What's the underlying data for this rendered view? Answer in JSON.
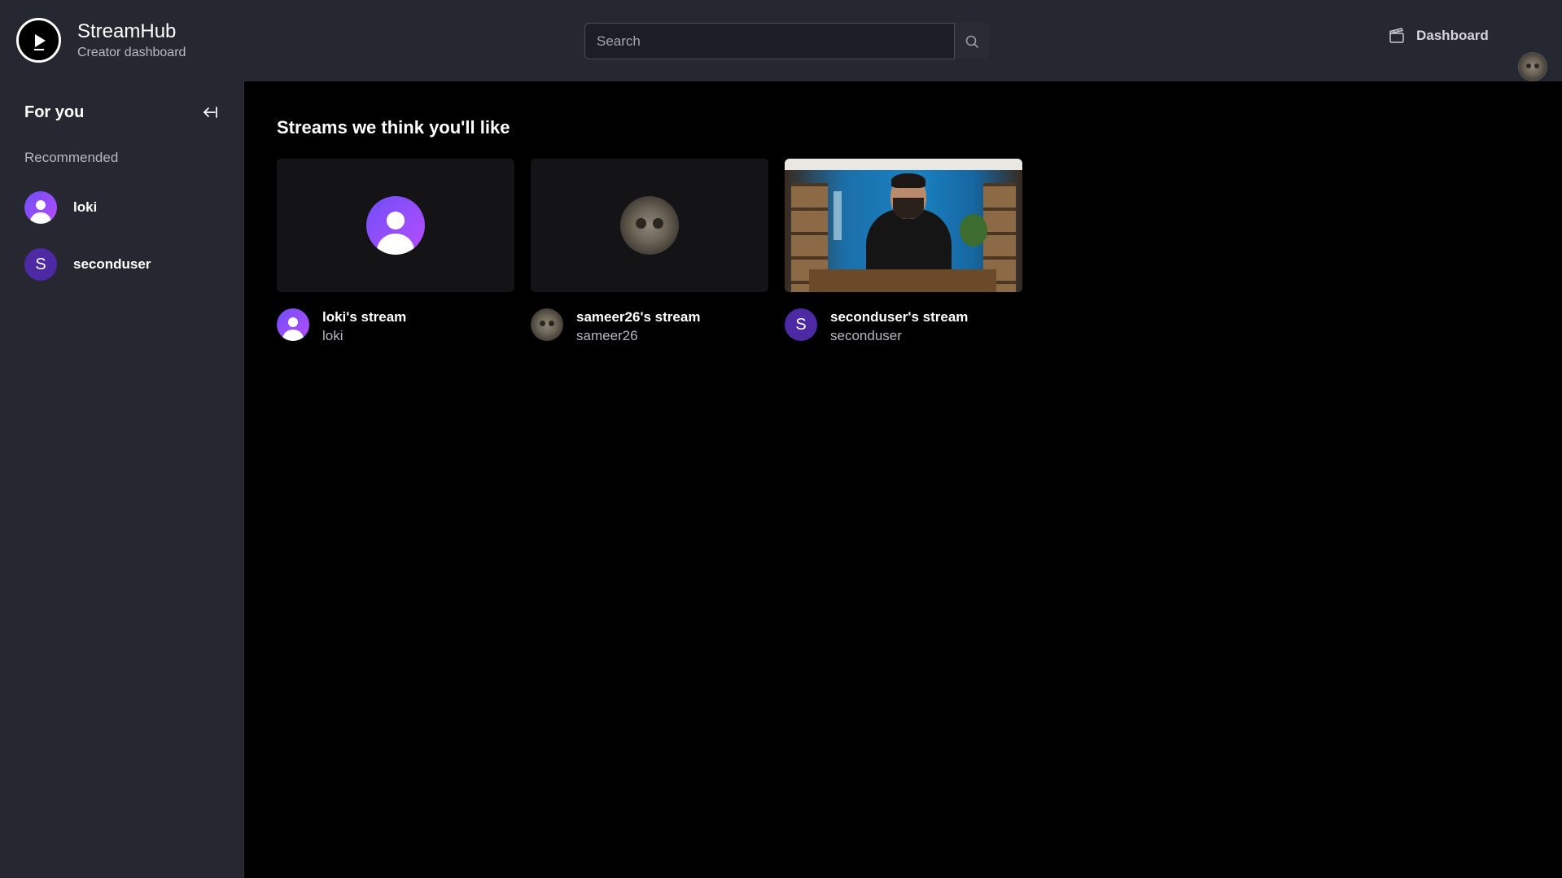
{
  "header": {
    "brand_name": "StreamHub",
    "brand_subtitle": "Creator dashboard",
    "search_placeholder": "Search",
    "dashboard_label": "Dashboard"
  },
  "sidebar": {
    "title": "For you",
    "section_label": "Recommended",
    "items": [
      {
        "name": "loki",
        "avatar": "default-user-icon"
      },
      {
        "name": "seconduser",
        "avatar_letter": "S"
      }
    ]
  },
  "main": {
    "title": "Streams we think you'll like",
    "streams": [
      {
        "title": "loki's stream",
        "username": "loki",
        "avatar": "default-user-icon",
        "thumbnail": "avatar-placeholder"
      },
      {
        "title": "sameer26's stream",
        "username": "sameer26",
        "avatar": "owl-photo",
        "thumbnail": "avatar-placeholder"
      },
      {
        "title": "seconduser's stream",
        "username": "seconduser",
        "avatar_letter": "S",
        "thumbnail": "live-video-frame"
      }
    ]
  },
  "colors": {
    "header_bg": "#252731",
    "sidebar_bg": "#262731",
    "main_bg": "#000000",
    "avatar_gradient_start": "#6f4ef5",
    "avatar_gradient_end": "#b74dff",
    "letter_avatar_bg": "#4d2aa3"
  }
}
